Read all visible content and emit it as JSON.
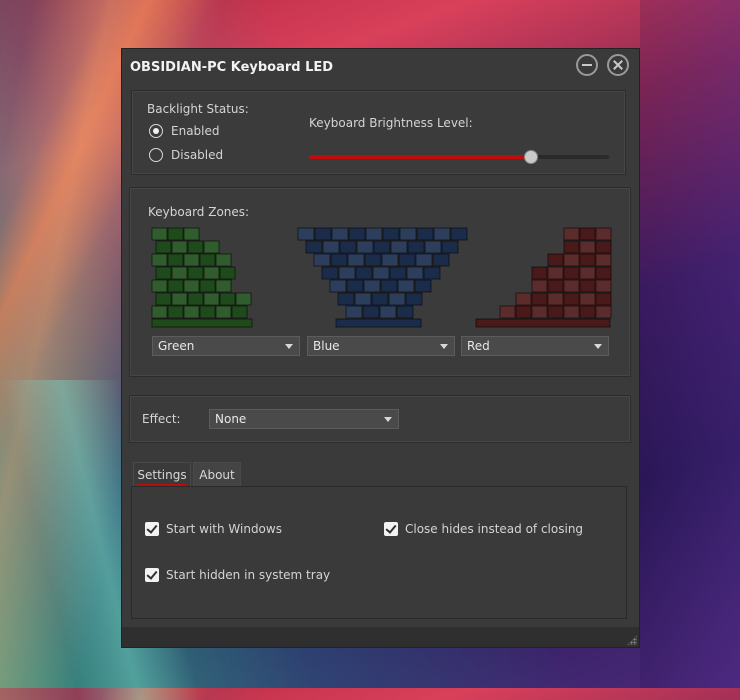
{
  "window": {
    "title": "OBSIDIAN-PC Keyboard LED"
  },
  "backlight": {
    "status_label": "Backlight Status:",
    "options": [
      "Enabled",
      "Disabled"
    ],
    "selected": "Enabled",
    "brightness_label": "Keyboard Brightness Level:",
    "brightness_fraction": 0.74,
    "accent_color": "#c00c0c"
  },
  "zones": {
    "label": "Keyboard Zones:",
    "left": {
      "color_name": "Green",
      "color": "#1f4a1c"
    },
    "middle": {
      "color_name": "Blue",
      "color": "#1b2c4a"
    },
    "right": {
      "color_name": "Red",
      "color": "#4a1a1a"
    }
  },
  "effect": {
    "label": "Effect:",
    "value": "None"
  },
  "tabs": {
    "items": [
      "Settings",
      "About"
    ],
    "active": "Settings"
  },
  "settings": {
    "start_with_windows": "Start with Windows",
    "close_hides": "Close hides instead of closing",
    "start_hidden": "Start hidden in system tray",
    "start_with_windows_checked": true,
    "close_hides_checked": true,
    "start_hidden_checked": true
  },
  "icons": {
    "minimize": "minimize-circle-icon",
    "close": "close-circle-icon",
    "dropdown": "chevron-down-icon",
    "resize": "resize-grip-icon"
  }
}
